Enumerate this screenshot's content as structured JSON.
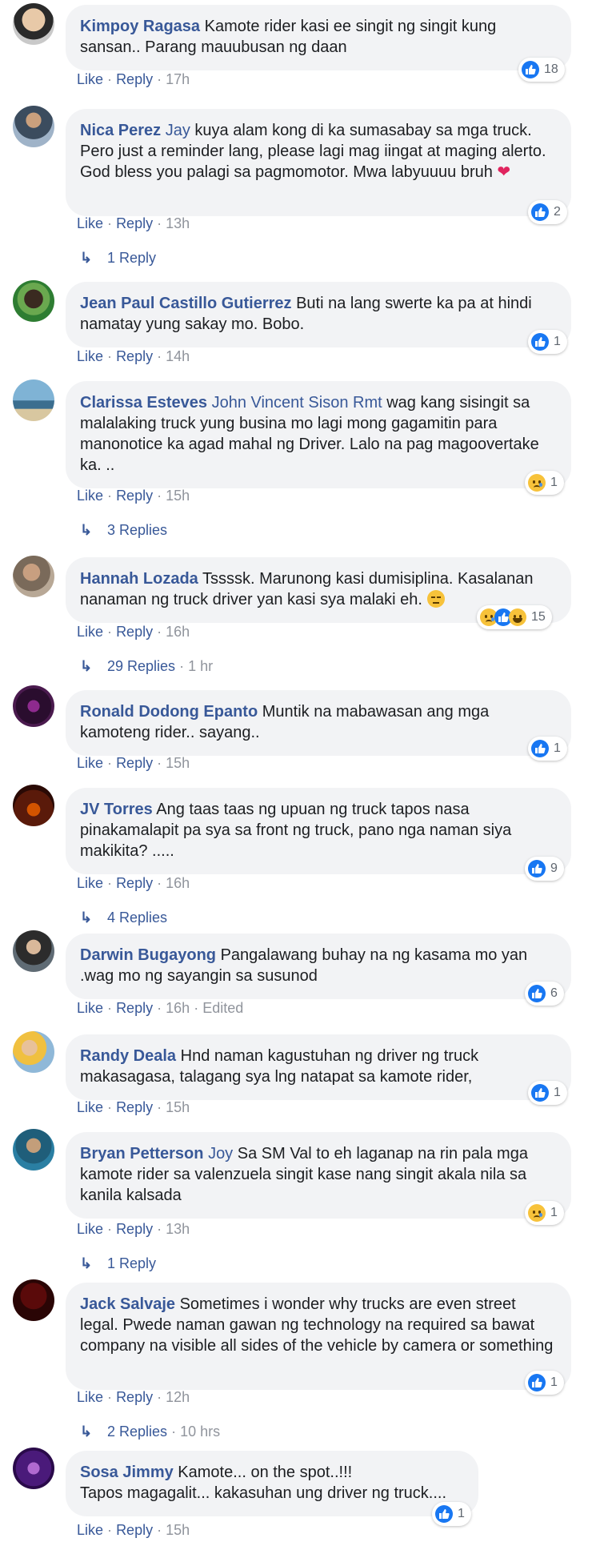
{
  "actions": {
    "like": "Like",
    "reply": "Reply",
    "separator": "·",
    "edited": "Edited"
  },
  "comments": [
    {
      "author": "Kimpoy Ragasa",
      "mention": "",
      "text": "Kamote rider kasi ee singit ng singit kung sansan.. Parang mauubusan ng daan",
      "time": "17h",
      "reactions": "18",
      "replies": ""
    },
    {
      "author": "Nica Perez",
      "mention": "Jay",
      "text": "kuya alam kong di ka sumasabay sa mga truck. Pero just a reminder lang, please lagi mag iingat at maging alerto. God bless you palagi sa pagmomotor. Mwa labyuuuu bruh",
      "time": "13h",
      "reactions": "2",
      "replies": "1 Reply"
    },
    {
      "author": "Jean Paul Castillo Gutierrez",
      "mention": "",
      "text": "Buti na lang swerte ka pa at hindi namatay yung sakay mo. Bobo.",
      "time": "14h",
      "reactions": "1",
      "replies": ""
    },
    {
      "author": "Clarissa Esteves",
      "mention": "John Vincent Sison Rmt",
      "text": "wag kang sisingit sa malalaking truck yung businа mo lagi mong gagamitin para manonotice ka agad mahal ng Driver. Lalo na pag magoovertake ka. ..",
      "time": "15h",
      "reactions": "1",
      "replies": "3 Replies"
    },
    {
      "author": "Hannah Lozada",
      "mention": "",
      "text": "Tssssk. Marunong kasi dumisiplina. Kasalanan nanaman ng truck driver yan kasi sya malaki eh.",
      "time": "16h",
      "reactions": "15",
      "replies": "29 Replies",
      "replies_time": "1 hr"
    },
    {
      "author": "Ronald Dodong Epanto",
      "mention": "",
      "text": "Muntik na mabawasan ang mga kamoteng rider.. sayang..",
      "time": "15h",
      "reactions": "1",
      "replies": ""
    },
    {
      "author": "JV Torres",
      "mention": "",
      "text": "Ang taas taas ng upuan ng truck tapos nasa pinakamalapit pa sya sa front ng truck, pano nga naman siya makikita? .....",
      "time": "16h",
      "reactions": "9",
      "replies": "4 Replies"
    },
    {
      "author": "Darwin Bugayong",
      "mention": "",
      "text": "Pangalawang buhay na ng kasama mo yan .wag mo ng sayangin sa susunod",
      "time": "16h",
      "reactions": "6",
      "replies": ""
    },
    {
      "author": "Randy Deala",
      "mention": "",
      "text": "Hnd naman kagustuhan ng driver ng truck makasagasa, talagang sya lng natapat sa kamote rider,",
      "time": "15h",
      "reactions": "1",
      "replies": ""
    },
    {
      "author": "Bryan Petterson",
      "mention": "Joy",
      "text": "Sa SM Val to eh laganap na rin pala mga kamote rider sa valenzuela singit kase nang singit akala nila sa kanila kalsada",
      "time": "13h",
      "reactions": "1",
      "replies": "1 Reply"
    },
    {
      "author": "Jack Salvaje",
      "mention": "",
      "text": "Sometimes i wonder why trucks are even street legal. Pwede naman gawan ng technology na required sa bawat company na visible all sides of the vehicle by camera or something",
      "time": "12h",
      "reactions": "1",
      "replies": "2 Replies",
      "replies_time": "10 hrs"
    },
    {
      "author": "Sosa Jimmy",
      "mention": "",
      "text": "Kamote... on the spot..!!!",
      "text2": "Tapos magagalit... kakasuhan ung driver ng truck....",
      "time": "15h",
      "reactions": "1",
      "replies": ""
    }
  ],
  "colors": {
    "link": "#385898",
    "bubble": "#f2f3f5",
    "like_blue": "#1877f2",
    "muted": "#90949c"
  }
}
